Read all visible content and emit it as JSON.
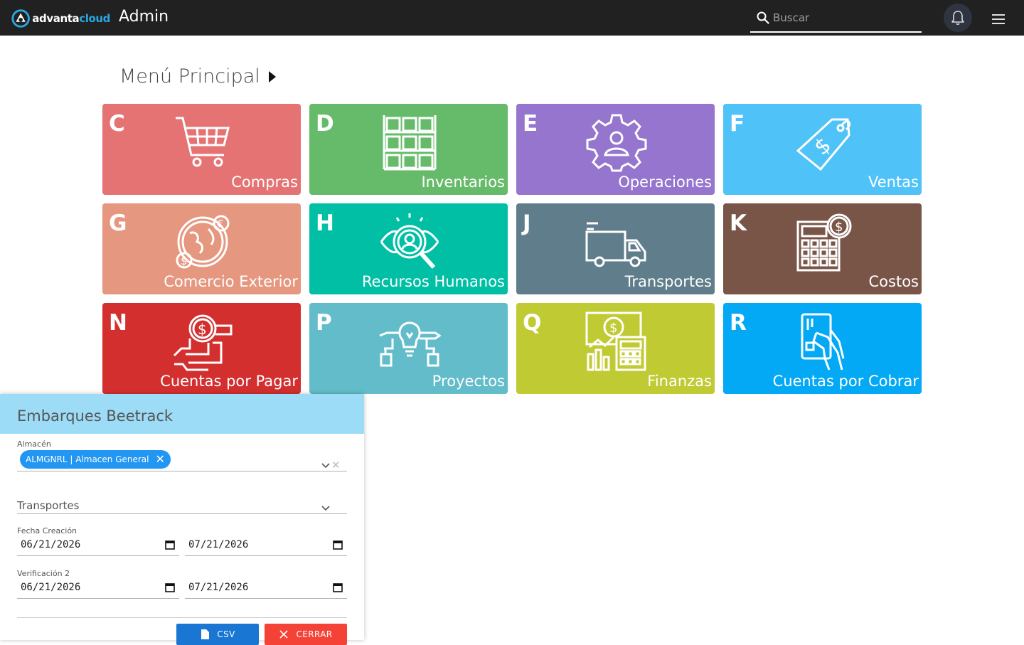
{
  "header": {
    "logo_plain": "advanta",
    "logo_accent": "cloud",
    "app_title": "Admin",
    "search_placeholder": "Buscar"
  },
  "page_title": "Menú Principal",
  "tiles": [
    {
      "letter": "C",
      "label": "Compras",
      "color": "#e57373",
      "icon": "shopping-cart-icon"
    },
    {
      "letter": "D",
      "label": "Inventarios",
      "color": "#66bb6a",
      "icon": "warehouse-boxes-icon"
    },
    {
      "letter": "E",
      "label": "Operaciones",
      "color": "#9575cd",
      "icon": "gear-person-icon"
    },
    {
      "letter": "F",
      "label": "Ventas",
      "color": "#4fc3f7",
      "icon": "price-tag-icon"
    },
    {
      "letter": "G",
      "label": "Comercio Exterior",
      "color": "#e5977f",
      "icon": "globe-currency-icon"
    },
    {
      "letter": "H",
      "label": "Recursos Humanos",
      "color": "#00bfa5",
      "icon": "talent-search-icon"
    },
    {
      "letter": "J",
      "label": "Transportes",
      "color": "#607d8b",
      "icon": "truck-icon"
    },
    {
      "letter": "K",
      "label": "Costos",
      "color": "#795548",
      "icon": "calculator-dollar-icon"
    },
    {
      "letter": "N",
      "label": "Cuentas por Pagar",
      "color": "#d32f2f",
      "icon": "hand-coin-icon"
    },
    {
      "letter": "P",
      "label": "Proyectos",
      "color": "#63bcc9",
      "icon": "idea-project-icon"
    },
    {
      "letter": "Q",
      "label": "Finanzas",
      "color": "#c0ca33",
      "icon": "finance-calculator-icon"
    },
    {
      "letter": "R",
      "label": "Cuentas por Cobrar",
      "color": "#03a9f4",
      "icon": "card-payment-icon"
    }
  ],
  "panel": {
    "title": "Embarques Beetrack",
    "almacen_label": "Almacén",
    "almacen_chip": "ALMGNRL | Almacen General",
    "transportes_label": "Transportes",
    "fecha_creacion_label": "Fecha Creación",
    "fecha_creacion_from": "06/21/2026",
    "fecha_creacion_to": "07/21/2026",
    "verificacion_label": "Verificación 2",
    "verificacion_from": "06/21/2026",
    "verificacion_to": "07/21/2026",
    "csv_label": "CSV",
    "cerrar_label": "CERRAR",
    "csv_color": "#1976d2",
    "cerrar_color": "#f44336"
  }
}
